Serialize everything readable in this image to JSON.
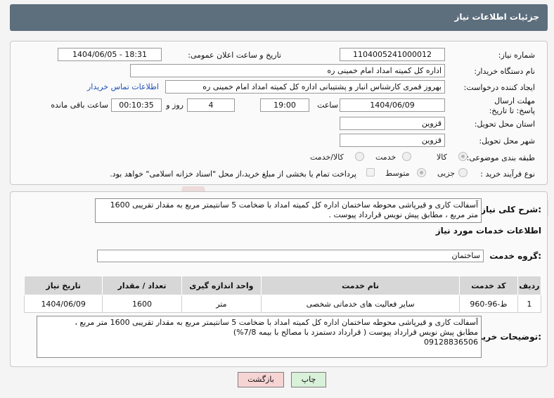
{
  "header": {
    "title": "جزئیات اطلاعات نیاز"
  },
  "fields": {
    "need_number_label": "شماره نیاز:",
    "need_number": "1104005241000012",
    "announce_label": "تاریخ و ساعت اعلان عمومی:",
    "announce_value": "1404/06/05 - 18:31",
    "buyer_org_label": "نام دستگاه خریدار:",
    "buyer_org": "اداره کل کمیته امداد امام خمینی  ره",
    "creator_label": "ایجاد کننده درخواست:",
    "creator": "بهروز قمری کارشناس انبار و پشتیبانی اداره کل کمیته امداد امام خمینی  ره",
    "contact_link": "اطلاعات تماس خریدار",
    "deadline_label": "مهلت ارسال پاسخ: تا تاریخ:",
    "deadline_date": "1404/06/09",
    "time_label": "ساعت",
    "deadline_time": "19:00",
    "days_value": "4",
    "days_label": "روز و",
    "remaining_time": "00:10:35",
    "remaining_label": "ساعت باقی مانده",
    "province_label": "استان محل تحویل:",
    "province": "قزوین",
    "city_label": "شهر محل تحویل:",
    "city": "قزوین",
    "category_label": "طبقه بندی موضوعی:",
    "category_options": [
      "کالا",
      "خدمت",
      "کالا/خدمت"
    ],
    "process_label": "نوع فرآیند خرید :",
    "process_options": [
      "جزیی",
      "متوسط"
    ],
    "payment_note": "پرداخت تمام یا بخشی از مبلغ خرید،از محل \"اسناد خزانه اسلامی\" خواهد بود."
  },
  "description": {
    "label": "شرح کلی نیاز:",
    "text": "آسفالت کاری و قیرپاشی محوطه ساختمان اداره کل کمیته امداد با ضخامت 5 سانتیمتر مربع به مقدار تقریبی 1600 متر مربع ، مطابق پیش نویس قرارداد پیوست ."
  },
  "services": {
    "section_title": "اطلاعات خدمات مورد نیاز",
    "group_label": "گروه خدمت:",
    "group_value": "ساختمان",
    "columns": [
      "ردیف",
      "کد خدمت",
      "نام خدمت",
      "واحد اندازه گیری",
      "تعداد / مقدار",
      "تاریخ نیاز"
    ],
    "rows": [
      [
        "1",
        "ط-96-960",
        "سایر فعالیت های خدماتی شخصی",
        "متر",
        "1600",
        "1404/06/09"
      ]
    ]
  },
  "buyer_notes": {
    "label": "توضیحات خریدار:",
    "line1": "آسفالت کاری و قیرپاشی محوطه ساختمان اداره کل کمیته امداد با ضخامت 5 سانتیمتر مربع به مقدار تقریبی 1600 متر مربع ،",
    "line2": "مطابق پیش نویس قرارداد پیوست ( قرارداد دستمزد با مصالح با بیمه 7/8%)",
    "line3": "09128836506"
  },
  "buttons": {
    "print": "چاپ",
    "back": "بازگشت"
  },
  "colors": {
    "header": "#5d6e7d",
    "link": "#1f4fb8",
    "back_button": "#f7d4d4",
    "print_button": "#d9f0d9"
  }
}
